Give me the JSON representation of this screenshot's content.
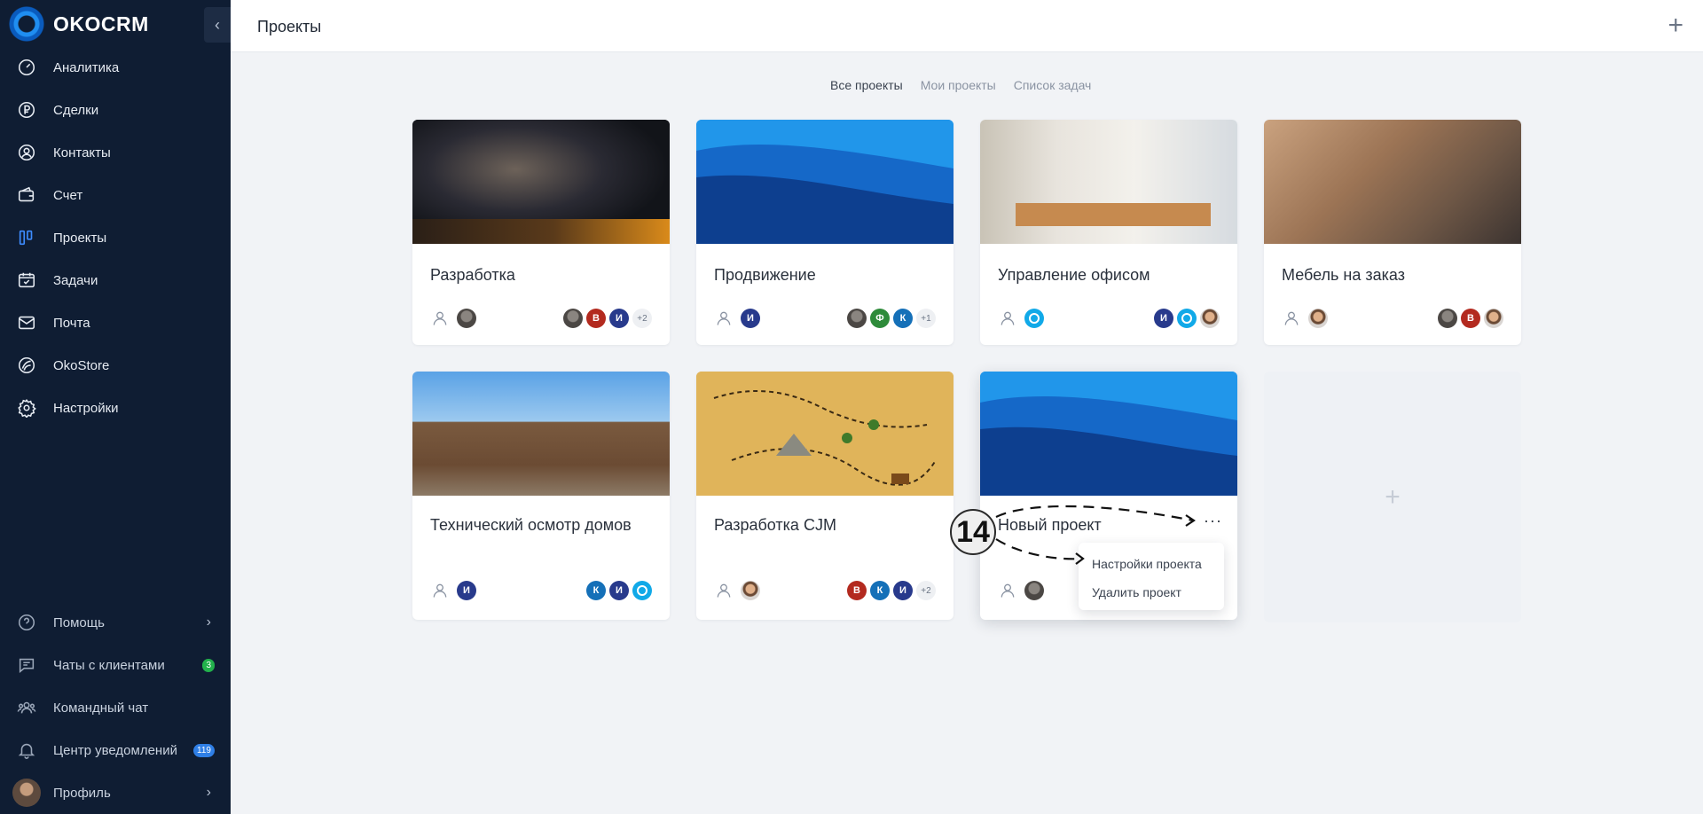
{
  "brand": {
    "name": "OKOCRM"
  },
  "sidebar": {
    "items": [
      {
        "label": "Аналитика",
        "icon": "gauge-icon",
        "active": false
      },
      {
        "label": "Сделки",
        "icon": "ruble-icon",
        "active": false
      },
      {
        "label": "Контакты",
        "icon": "user-circle-icon",
        "active": false
      },
      {
        "label": "Счет",
        "icon": "wallet-icon",
        "active": false
      },
      {
        "label": "Проекты",
        "icon": "kanban-icon",
        "active": true
      },
      {
        "label": "Задачи",
        "icon": "calendar-check-icon",
        "active": false
      },
      {
        "label": "Почта",
        "icon": "mail-icon",
        "active": false
      },
      {
        "label": "OkoStore",
        "icon": "store-icon",
        "active": false
      },
      {
        "label": "Настройки",
        "icon": "gear-icon",
        "active": false
      }
    ],
    "bottom": [
      {
        "label": "Помощь",
        "icon": "help-icon"
      },
      {
        "label": "Чаты с клиентами",
        "icon": "chat-icon",
        "badge": "3"
      },
      {
        "label": "Командный чат",
        "icon": "team-icon"
      },
      {
        "label": "Центр уведомлений",
        "icon": "bell-icon",
        "badge": "119"
      },
      {
        "label": "Профиль",
        "icon": "avatar"
      }
    ]
  },
  "header": {
    "title": "Проекты"
  },
  "tabs": [
    "Все проекты",
    "Мои проекты",
    "Список задач"
  ],
  "projects": [
    {
      "title": "Разработка",
      "more": "+2",
      "members": [
        "В",
        "И"
      ]
    },
    {
      "title": "Продвижение",
      "owner": "И",
      "more": "+1",
      "members": [
        "Ф",
        "К"
      ]
    },
    {
      "title": "Управление офисом",
      "members": [
        "И"
      ]
    },
    {
      "title": "Мебель на заказ",
      "members": [
        "В"
      ]
    },
    {
      "title": "Технический осмотр домов",
      "owner": "И",
      "members": [
        "К",
        "И"
      ]
    },
    {
      "title": "Разработка CJM",
      "more": "+2",
      "members": [
        "В",
        "К",
        "И"
      ]
    },
    {
      "title": "Новый проект"
    }
  ],
  "context_menu": {
    "items": [
      "Настройки проекта",
      "Удалить проект"
    ],
    "more_label": "···"
  },
  "add_card": {
    "icon": "plus-icon",
    "label": "+"
  },
  "annotation": {
    "step": "14"
  },
  "colors": {
    "sidebar": "#0f1d33",
    "accent": "#3d8cff",
    "avatar_blue": "#283a8c",
    "avatar_red": "#b32a1f",
    "avatar_green": "#2e8b3a",
    "avatar_teal": "#1570b8"
  }
}
